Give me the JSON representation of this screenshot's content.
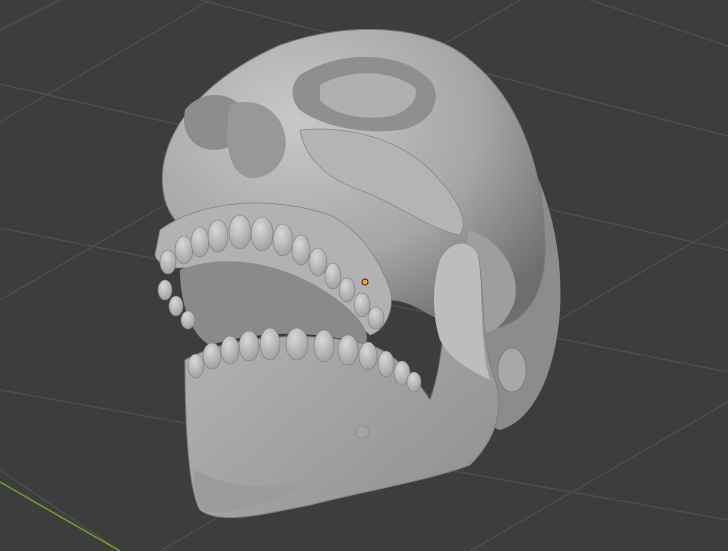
{
  "viewport": {
    "background_color": "#3d3d3d",
    "grid_color": "#4f4f4f",
    "axis_x_color": "#6f9a2c",
    "object": {
      "kind": "skull-mesh",
      "material_color": "#a6a6a6",
      "shadow_color": "#6b6b6b",
      "highlight_color": "#cfcfcf"
    },
    "origin_dot_color": "#f5a623",
    "icons": {
      "origin": "origin-dot-icon"
    }
  }
}
